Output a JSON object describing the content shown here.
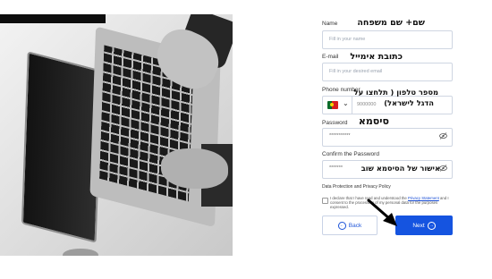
{
  "form": {
    "name_label": "Name",
    "name_placeholder": "Fill in your name",
    "name_hebrew": "שם+ שם משפחה",
    "email_label": "E-mail",
    "email_placeholder": "Fill in your desired email",
    "email_hebrew": "כתובת אימייל",
    "phone_label": "Phone number",
    "phone_value": "9000000",
    "phone_hebrew_line1": "מספר טלפון ( תלחצו על",
    "phone_hebrew_line2": "הדגל לישראל)",
    "password_label": "Password",
    "password_value": "***********",
    "password_hebrew": "סיסמא",
    "confirm_label": "Confirm the Password",
    "confirm_value": "*******",
    "confirm_hebrew": "אישור של הסיסמא שוב",
    "privacy_heading": "Data Protection and Privacy Policy",
    "terms_text_1": "I declare that I have read and understood the ",
    "terms_link": "Privacy Statement",
    "terms_text_2": " and I consent to the processing of my personal data for the purposes expressed.",
    "back_label": "Back",
    "next_label": "Next"
  },
  "icons": {
    "eye": "eye-slash-icon",
    "flag": "portugal-flag-icon",
    "back": "arrow-left-circle-icon",
    "next": "arrow-right-circle-icon",
    "pointer": "black-arrow-annotation"
  },
  "colors": {
    "primary": "#1554e0",
    "input_border": "#cfd6e2",
    "link": "#1b4fd6"
  }
}
